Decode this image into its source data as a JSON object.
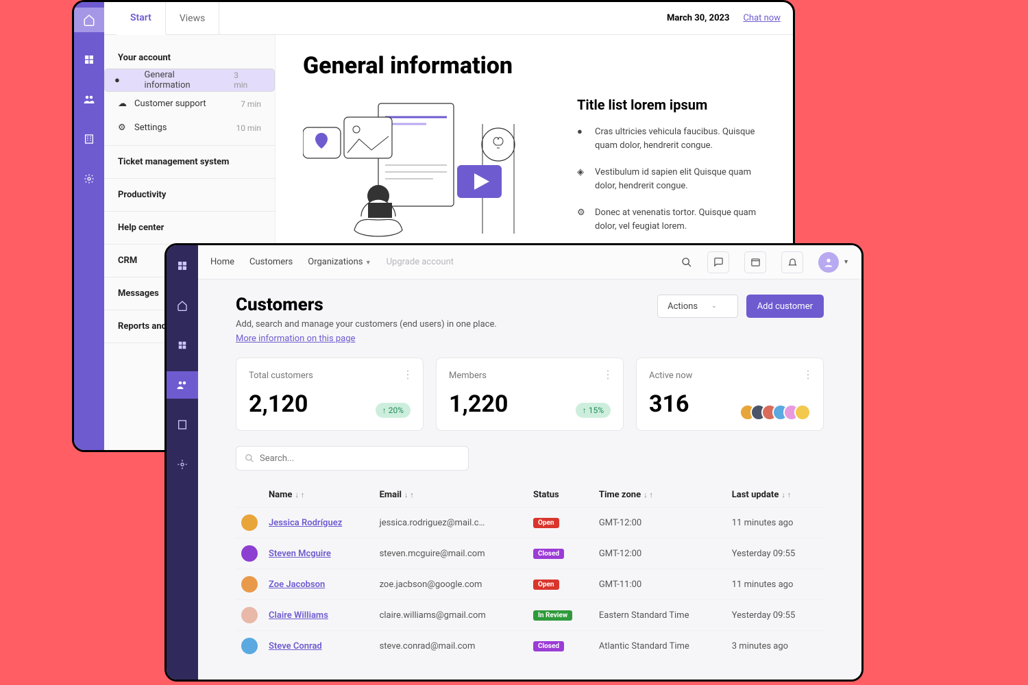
{
  "w1": {
    "tabs": [
      "Start",
      "Views"
    ],
    "date": "March 30, 2023",
    "chat": "Chat now",
    "side": {
      "h1": "Your account",
      "items": [
        {
          "label": "General information",
          "min": "3 min"
        },
        {
          "label": "Customer support",
          "min": "7 min"
        },
        {
          "label": "Settings",
          "min": "10 min"
        }
      ],
      "extra": [
        "Ticket management system",
        "Productivity",
        "Help center",
        "CRM",
        "Messages",
        "Reports and analytics"
      ]
    },
    "title": "General information",
    "listTitle": "Title list lorem ipsum",
    "bullets": [
      "Cras ultricies vehicula faucibus. Quisque quam dolor, hendrerit congue.",
      "Vestibulum id sapien elit Quisque quam dolor, hendrerit congue.",
      "Donec at venenatis tortor. Quisque quam dolor, vel feugiat lorem."
    ]
  },
  "w2": {
    "nav": {
      "home": "Home",
      "cust": "Customers",
      "org": "Organizations",
      "upg": "Upgrade account"
    },
    "page": {
      "title": "Customers",
      "sub": "Add, search and manage your customers (end users) in one place.",
      "link": "More information on this page",
      "actions": "Actions",
      "add": "Add customer"
    },
    "cards": [
      {
        "label": "Total customers",
        "value": "2,120",
        "pill": "↑  20%"
      },
      {
        "label": "Members",
        "value": "1,220",
        "pill": "↑  15%"
      },
      {
        "label": "Active now",
        "value": "316"
      }
    ],
    "searchPlaceholder": "Search...",
    "cols": {
      "name": "Name",
      "email": "Email",
      "status": "Status",
      "tz": "Time zone",
      "last": "Last update"
    },
    "rows": [
      {
        "name": "Jessica Rodríguez",
        "email": "jessica.rodriguez@mail.c…",
        "status": "Open",
        "scls": "b-open",
        "tz": "GMT-12:00",
        "last": "11 minutes ago",
        "av": "#e8a53a"
      },
      {
        "name": "Steven Mcguire",
        "email": "steven.mcguire@mail.com",
        "status": "Closed",
        "scls": "b-closed",
        "tz": "GMT-12:00",
        "last": "Yesterday 09:55",
        "av": "#8d3fd1"
      },
      {
        "name": "Zoe Jacobson",
        "email": "zoe.jacbson@google.com",
        "status": "Open",
        "scls": "b-open",
        "tz": "GMT-11:00",
        "last": "11 minutes ago",
        "av": "#e89a4a"
      },
      {
        "name": "Claire Williams",
        "email": "claire.williams@gmail.com",
        "status": "In Review",
        "scls": "b-review",
        "tz": "Eastern Standard Time",
        "last": "Yesterday 09:55",
        "av": "#e8b8a8"
      },
      {
        "name": "Steve Conrad",
        "email": "steve.conrad@mail.com",
        "status": "Closed",
        "scls": "b-closed",
        "tz": "Atlantic Standard Time",
        "last": "3 minutes ago",
        "av": "#5aa9e0"
      }
    ],
    "avColors": [
      "#e8a53a",
      "#4a5568",
      "#d96b5a",
      "#5aa9e0",
      "#e89adf",
      "#f2c94c"
    ]
  }
}
